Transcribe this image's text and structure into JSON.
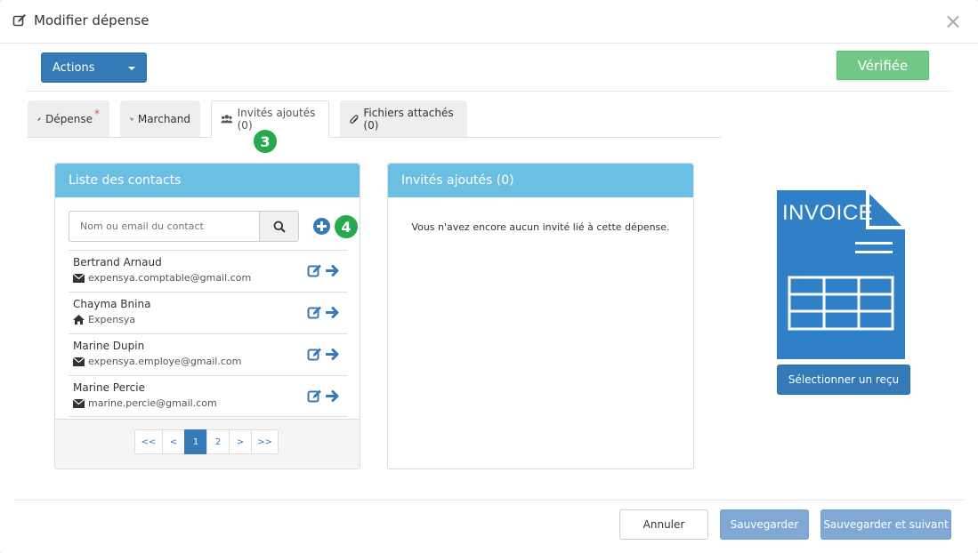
{
  "modal": {
    "title": "Modifier dépense",
    "close_glyph": "×"
  },
  "toolbar": {
    "actions_label": "Actions",
    "verified_label": "Vérifiée"
  },
  "tabs": [
    {
      "label": "Dépense",
      "required_mark": "*",
      "icon": "pencil-icon"
    },
    {
      "label": "Marchand",
      "icon": "cart-icon"
    },
    {
      "label": "Invités ajoutés (0)",
      "icon": "users-icon"
    },
    {
      "label": "Fichiers attachés (0)",
      "icon": "paperclip-icon"
    }
  ],
  "badges": {
    "step3": "3",
    "step4": "4"
  },
  "contacts": {
    "title": "Liste des contacts",
    "search_placeholder": "Nom ou email du contact",
    "items": [
      {
        "name": "Bertrand Arnaud",
        "detail": "expensya.comptable@gmail.com",
        "detail_icon": "envelope-icon"
      },
      {
        "name": "Chayma Bnina",
        "detail": "Expensya",
        "detail_icon": "home-icon"
      },
      {
        "name": "Marine Dupin",
        "detail": "expensya.employe@gmail.com",
        "detail_icon": "envelope-icon"
      },
      {
        "name": "Marine Percie",
        "detail": "marine.percie@gmail.com",
        "detail_icon": "envelope-icon"
      }
    ],
    "pagination": [
      "<<",
      "<",
      "1",
      "2",
      ">",
      ">>"
    ],
    "current_page": "1"
  },
  "guests": {
    "title": "Invités ajoutés (0)",
    "empty_message": "Vous n'avez encore aucun invité lié à cette dépense."
  },
  "invoice": {
    "label": "INVOICE",
    "select_label": "Sélectionner un reçu"
  },
  "footer": {
    "cancel": "Annuler",
    "save": "Sauvegarder",
    "save_next": "Sauvegarder et suivant"
  },
  "colors": {
    "primary": "#337ab7",
    "panel_heading": "#6bbfe3",
    "verified": "#72c987",
    "badge": "#27a94f",
    "invoice": "#2f80c6"
  }
}
